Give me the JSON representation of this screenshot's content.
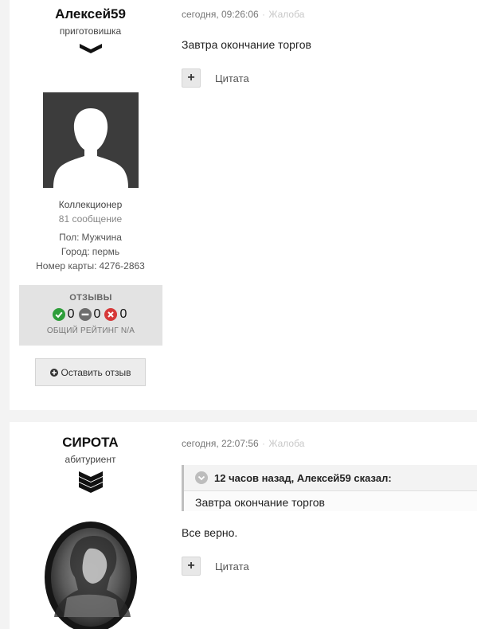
{
  "colors": {
    "positive": "#2e9e3a",
    "neutral": "#6d6d6d",
    "negative": "#d63838",
    "page_bg": "#f3f3f3"
  },
  "posts": [
    {
      "author": {
        "name": "Алексей59",
        "rank": "приготовишка",
        "rank_icon": "chevron-down-icon",
        "avatar_icon": "default-avatar-silhouette",
        "title": "Коллекционер",
        "posts_count": "81 сообщение",
        "fields": [
          {
            "label": "Пол:",
            "value": "Мужчина"
          },
          {
            "label": "Город:",
            "value": "пермь"
          },
          {
            "label": "Номер карты:",
            "value": "4276-2863"
          }
        ],
        "reviews": {
          "title": "ОТЗЫВЫ",
          "positive": "0",
          "neutral": "0",
          "negative": "0",
          "rating": "ОБЩИЙ РЕЙТИНГ N/A"
        },
        "leave_review_label": "Оставить отзыв"
      },
      "date": "сегодня, 09:26:06",
      "separator": "·",
      "report_label": "Жалоба",
      "text": "Завтра окончание торгов",
      "quote_label": "Цитата"
    },
    {
      "author": {
        "name": "СИРОТА",
        "rank": "абитуриент",
        "rank_icon": "triple-chevron-icon",
        "avatar_icon": "portrait-engraving"
      },
      "date": "сегодня, 22:07:56",
      "separator": "·",
      "report_label": "Жалоба",
      "quote": {
        "header": "12 часов назад, Алексей59 сказал:",
        "text": "Завтра окончание торгов"
      },
      "text": "Все верно.",
      "quote_label": "Цитата"
    }
  ]
}
